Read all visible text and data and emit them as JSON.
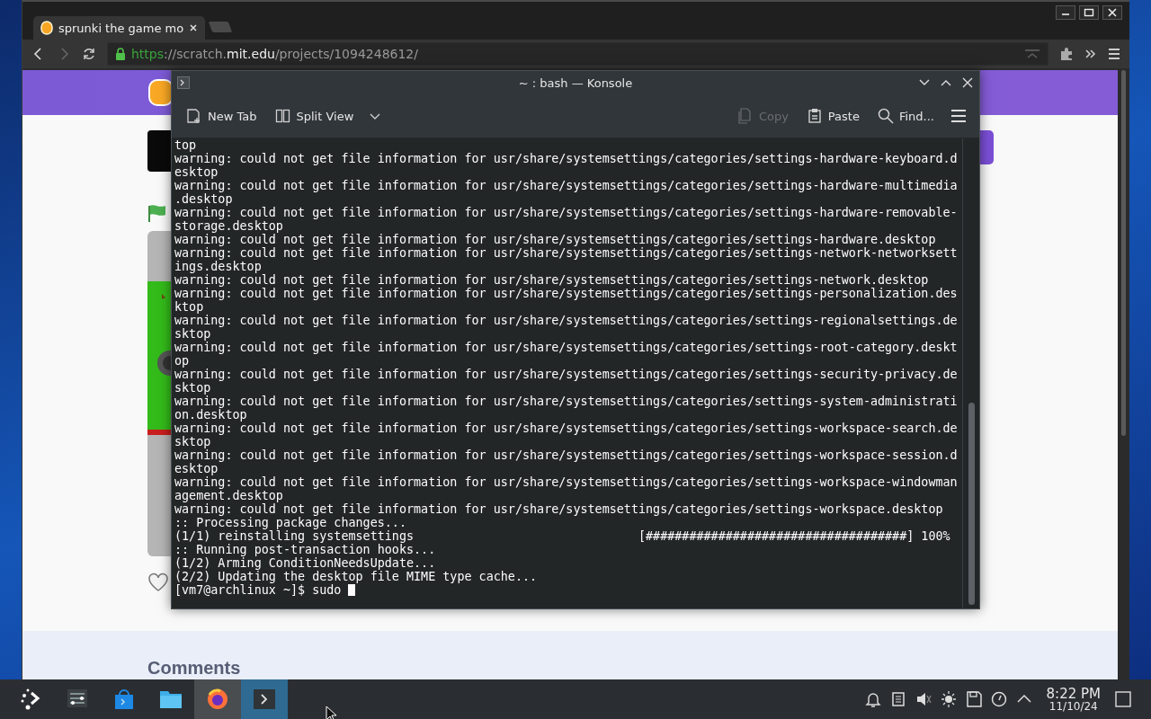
{
  "browser": {
    "tabs": [
      {
        "title": "sprunki the game mo",
        "selected": true
      }
    ],
    "nav": {
      "forward_disabled": true
    },
    "url": [
      {
        "text": "https",
        "kind": "scheme"
      },
      {
        "text": "://scratch.",
        "kind": "dim"
      },
      {
        "text": "mit.edu",
        "kind": "host"
      },
      {
        "text": "/projects/1094248612/",
        "kind": "dim"
      }
    ],
    "page": {
      "heading": "Comments"
    }
  },
  "konsole": {
    "title": "~ : bash — Konsole",
    "toolbar_left": [
      {
        "label": "New Tab",
        "disabled": false
      },
      {
        "label": "Split View",
        "disabled": false
      }
    ],
    "toolbar_right": [
      {
        "label": "Copy",
        "disabled": true
      },
      {
        "label": "Paste",
        "disabled": false
      },
      {
        "label": "Find...",
        "disabled": false
      }
    ],
    "lines": [
      "top",
      "warning: could not get file information for usr/share/systemsettings/categories/settings-hardware-keyboard.d",
      "esktop",
      "warning: could not get file information for usr/share/systemsettings/categories/settings-hardware-multimedia",
      ".desktop",
      "warning: could not get file information for usr/share/systemsettings/categories/settings-hardware-removable-",
      "storage.desktop",
      "warning: could not get file information for usr/share/systemsettings/categories/settings-hardware.desktop",
      "warning: could not get file information for usr/share/systemsettings/categories/settings-network-networksett",
      "ings.desktop",
      "warning: could not get file information for usr/share/systemsettings/categories/settings-network.desktop",
      "warning: could not get file information for usr/share/systemsettings/categories/settings-personalization.des",
      "ktop",
      "warning: could not get file information for usr/share/systemsettings/categories/settings-regionalsettings.de",
      "sktop",
      "warning: could not get file information for usr/share/systemsettings/categories/settings-root-category.deskt",
      "op",
      "warning: could not get file information for usr/share/systemsettings/categories/settings-security-privacy.de",
      "sktop",
      "warning: could not get file information for usr/share/systemsettings/categories/settings-system-administrati",
      "on.desktop",
      "warning: could not get file information for usr/share/systemsettings/categories/settings-workspace-search.de",
      "sktop",
      "warning: could not get file information for usr/share/systemsettings/categories/settings-workspace-session.d",
      "esktop",
      "warning: could not get file information for usr/share/systemsettings/categories/settings-workspace-windowman",
      "agement.desktop",
      "warning: could not get file information for usr/share/systemsettings/categories/settings-workspace.desktop",
      ":: Processing package changes...",
      "(1/1) reinstalling systemsettings                               [####################################] 100%",
      ":: Running post-transaction hooks...",
      "(1/2) Arming ConditionNeedsUpdate...",
      "(2/2) Updating the desktop file MIME type cache..."
    ],
    "prompt": "[vm7@archlinux ~]$ sudo "
  },
  "taskbar": {
    "apps": [
      {
        "running": false,
        "selected": false
      },
      {
        "running": false,
        "selected": false
      },
      {
        "running": false,
        "selected": false
      },
      {
        "running": false,
        "selected": false
      },
      {
        "running": true,
        "selected": false
      },
      {
        "running": true,
        "selected": true
      }
    ],
    "clock": {
      "time": "8:22 PM",
      "date": "11/10/24"
    }
  }
}
